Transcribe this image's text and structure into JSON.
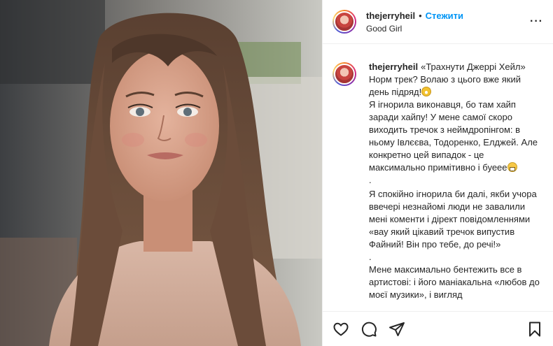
{
  "post": {
    "username": "thejerryheil",
    "separator": "•",
    "follow_label": "Стежити",
    "location": "Good Girl",
    "more_label": "···"
  },
  "caption": {
    "username": "thejerryheil",
    "paragraphs": [
      "«Трахнути Джеррі Хейл» Норм трек? Волаю з цього вже який день підряд!",
      "Я ігнорила виконавця, бо там хайп заради хайпу! У мене самої скоро виходить тречок з неймдропінгом: в ньому Івлєєва, Тодоренко, Елджей. Але конкретно цей випадок - це максимально примітивно і буеее",
      ".",
      "Я спокійно ігнорила би далі, якби учора ввечері незнайомі люди не завалили мені коменти і дірект повідомленнями «вау який цікавий тречок випустив Файний! Він про тебе, до речі!»",
      ".",
      "Мене максимально бентежить все в артистові: і його маніакальна «любов до моєї музики», і вигляд"
    ],
    "emoji": [
      "face-screaming-emoji",
      "grimacing-emoji"
    ]
  },
  "actions": {
    "icons": [
      "heart-icon",
      "comment-icon",
      "share-icon",
      "bookmark-icon"
    ]
  },
  "colors": {
    "accent": "#0095f6",
    "text": "#262626",
    "border": "#efefef"
  }
}
